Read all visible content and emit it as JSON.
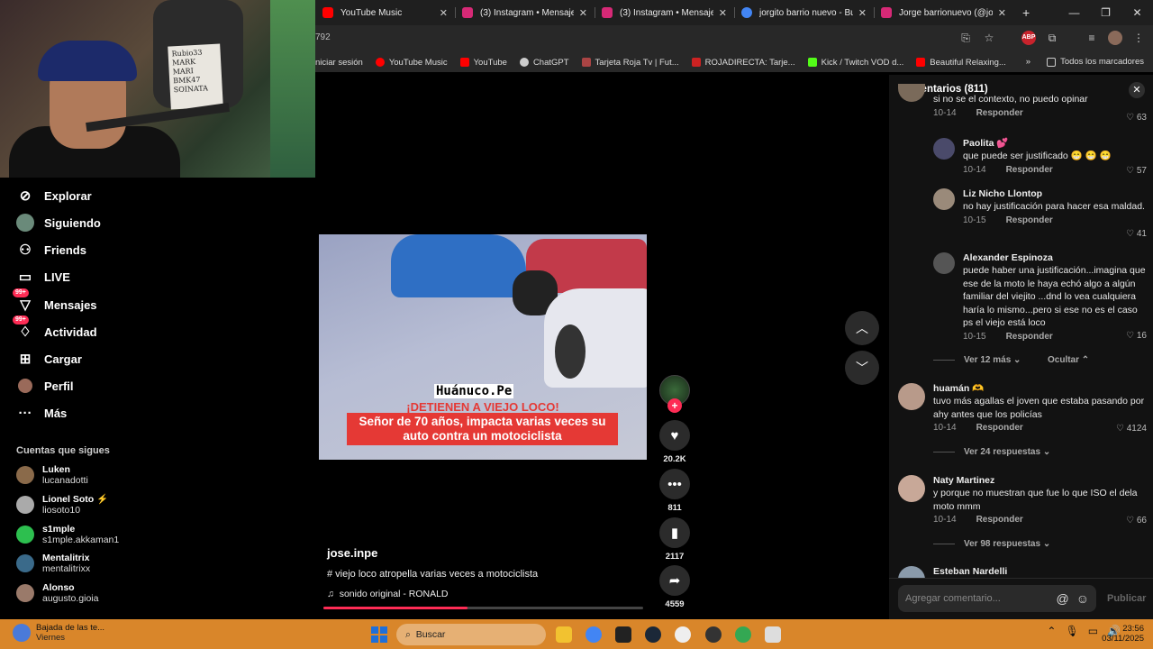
{
  "tabs": [
    {
      "title": "YouTube Music",
      "color": "#ff0000"
    },
    {
      "title": "(3) Instagram • Mensajes",
      "color": "#d62976"
    },
    {
      "title": "(3) Instagram • Mensajes",
      "color": "#d62976"
    },
    {
      "title": "jorgito barrio nuevo - Bu",
      "color": "#4285f4"
    },
    {
      "title": "Jorge barrionuevo (@jor",
      "color": "#d62976"
    }
  ],
  "address": {
    "url": "792"
  },
  "bookmarks": [
    {
      "label": "niciar sesión",
      "color": ""
    },
    {
      "label": "YouTube Music",
      "color": "#ff0000"
    },
    {
      "label": "YouTube",
      "color": "#ff0000"
    },
    {
      "label": "ChatGPT",
      "color": "#cccccc"
    },
    {
      "label": "Tarjeta Roja Tv | Fut...",
      "color": "#aa4444"
    },
    {
      "label": "ROJADIRECTA: Tarje...",
      "color": "#cc2222"
    },
    {
      "label": "Kick / Twitch VOD d...",
      "color": "#53fc18"
    },
    {
      "label": "Beautiful Relaxing...",
      "color": "#ff0000"
    }
  ],
  "bookmarks_all": "Todos los marcadores",
  "webcam": {
    "board_text": "Rubio33 MARK MARI BMK47 SOINATA"
  },
  "nav": [
    {
      "label": "Explorar",
      "icon": "compass-icon"
    },
    {
      "label": "Siguiendo",
      "icon": "following-icon"
    },
    {
      "label": "Friends",
      "icon": "friends-icon"
    },
    {
      "label": "LIVE",
      "icon": "live-icon"
    },
    {
      "label": "Mensajes",
      "icon": "messages-icon",
      "badge": "99+"
    },
    {
      "label": "Actividad",
      "icon": "activity-icon",
      "badge": "99+"
    },
    {
      "label": "Cargar",
      "icon": "upload-icon"
    },
    {
      "label": "Perfil",
      "icon": "profile-icon"
    },
    {
      "label": "Más",
      "icon": "more-icon"
    }
  ],
  "following_title": "Cuentas que sigues",
  "following": [
    {
      "name": "Luken",
      "handle": "lucanadotti",
      "color": "#8a6a4a"
    },
    {
      "name": "Lionel Soto",
      "handle": "liosoto10",
      "color": "#aaaaaa"
    },
    {
      "name": "s1mple",
      "handle": "s1mple.akkaman1",
      "color": "#2dbf4f"
    },
    {
      "name": "Mentalitrix",
      "handle": "mentalitrixx",
      "color": "#3a6a8a"
    },
    {
      "name": "Alonso",
      "handle": "augusto.gioia",
      "color": "#9a7a6a"
    }
  ],
  "video": {
    "watermark": "Huánuco.Pe",
    "headline": "¡DETIENEN A VIEJO LOCO!",
    "subtitle": "Señor de 70 años, impacta varias veces su auto contra un motociclista",
    "progress": 0.45
  },
  "actions": {
    "likes": "20.2K",
    "comments": "811",
    "saves": "2117",
    "shares": "4559"
  },
  "caption": {
    "user": "jose.inpe",
    "desc": "# viejo loco atropella varias veces a motociclista",
    "sound": "sonido original - RONALD"
  },
  "comments_panel": {
    "title": "Comentarios (811)",
    "items": [
      {
        "name": "",
        "text": "si no se el contexto, no puedo opinar",
        "date": "10-14",
        "reply": "Responder",
        "likes": "63"
      },
      {
        "name": "Paolita 💕",
        "text": "que puede ser justificado 😁 😁 😁",
        "date": "10-14",
        "reply": "Responder",
        "likes": "57"
      },
      {
        "name": "Liz Nicho Llontop",
        "text": "no hay justificación para hacer esa maldad.",
        "date": "10-15",
        "reply": "Responder",
        "likes": "41"
      },
      {
        "name": "Alexander Espinoza",
        "text": "puede haber una justificación...imagina que ese de la moto le haya echó algo a algún familiar del viejito ...dnd lo vea cualquiera haría lo mismo...pero si ese no es el caso ps el viejo está loco",
        "date": "10-15",
        "reply": "Responder",
        "likes": "16"
      },
      {
        "name": "huamán 🫶",
        "text": "tuvo más agallas el joven que estaba pasando por ahy antes que los policías",
        "date": "10-14",
        "reply": "Responder",
        "likes": "4124"
      },
      {
        "name": "Naty Martinez",
        "text": "y porque no muestran que fue lo que ISO el dela moto mmm",
        "date": "10-14",
        "reply": "Responder",
        "likes": "66"
      },
      {
        "name": "Esteban Nardelli",
        "text": "",
        "date": "",
        "reply": "",
        "likes": ""
      }
    ],
    "more1": "Ver 12 más",
    "hide": "Ocultar",
    "more2": "Ver 24 respuestas",
    "more3": "Ver 98 respuestas",
    "input_placeholder": "Agregar comentario...",
    "publish": "Publicar"
  },
  "taskbar": {
    "weather_line1": "Bajada de las te...",
    "weather_line2": "Viernes",
    "search": "Buscar",
    "time": "23:56",
    "date": "03/11/2025"
  }
}
